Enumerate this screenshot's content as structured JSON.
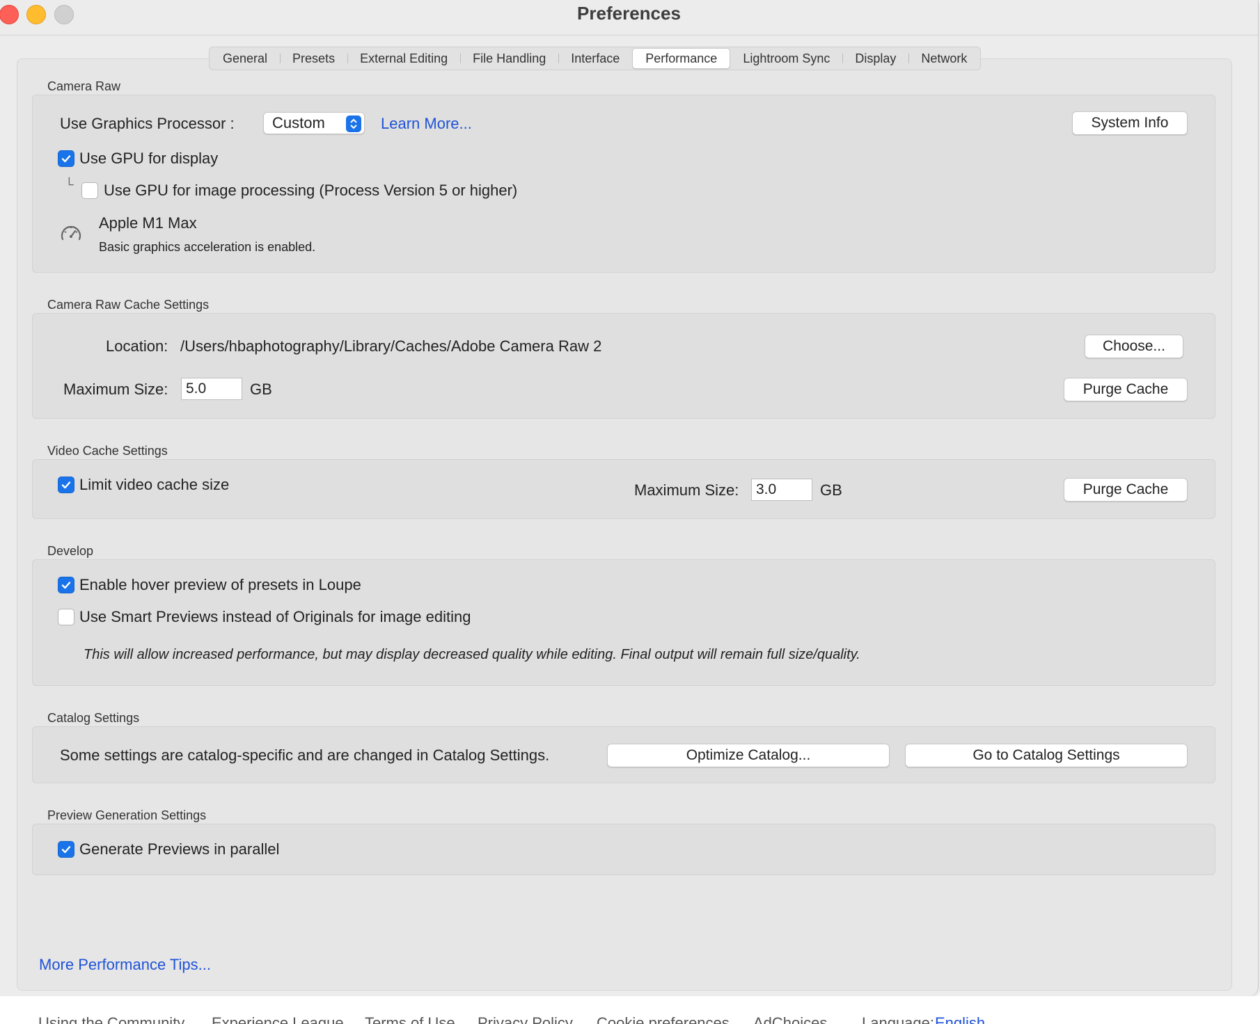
{
  "window": {
    "title": "Preferences"
  },
  "tabs": [
    {
      "label": "General"
    },
    {
      "label": "Presets"
    },
    {
      "label": "External Editing"
    },
    {
      "label": "File Handling"
    },
    {
      "label": "Interface"
    },
    {
      "label": "Performance",
      "active": true
    },
    {
      "label": "Lightroom Sync"
    },
    {
      "label": "Display"
    },
    {
      "label": "Network"
    }
  ],
  "camera_raw": {
    "section_label": "Camera Raw",
    "gpu_label": "Use Graphics Processor :",
    "gpu_value": "Custom",
    "learn_more": "Learn More...",
    "system_info": "System Info",
    "use_gpu_display": "Use GPU for display",
    "use_gpu_processing": "Use GPU for image processing (Process Version 5 or higher)",
    "gpu_name": "Apple M1 Max",
    "gpu_status": "Basic graphics acceleration is enabled."
  },
  "cache": {
    "section_label": "Camera Raw Cache Settings",
    "location_label": "Location:",
    "location_value": "/Users/hbaphotography/Library/Caches/Adobe Camera Raw 2",
    "choose": "Choose...",
    "max_size_label": "Maximum Size:",
    "max_size_value": "5.0",
    "unit": "GB",
    "purge": "Purge Cache"
  },
  "video_cache": {
    "section_label": "Video Cache Settings",
    "limit_label": "Limit video cache size",
    "max_size_label": "Maximum Size:",
    "max_size_value": "3.0",
    "unit": "GB",
    "purge": "Purge Cache"
  },
  "develop": {
    "section_label": "Develop",
    "hover_preview": "Enable hover preview of presets in Loupe",
    "smart_previews": "Use Smart Previews instead of Originals for image editing",
    "note": "This will allow increased performance, but may display decreased quality while editing. Final output will remain full size/quality."
  },
  "catalog": {
    "section_label": "Catalog Settings",
    "text": "Some settings are catalog-specific and are changed in Catalog Settings.",
    "optimize": "Optimize Catalog...",
    "goto": "Go to Catalog Settings"
  },
  "preview_gen": {
    "section_label": "Preview Generation Settings",
    "parallel": "Generate Previews in parallel"
  },
  "more_tips": "More Performance Tips...",
  "footer": {
    "items": [
      "Using the Community",
      "Experience League",
      "Terms of Use",
      "Privacy Policy",
      "Cookie preferences",
      "AdChoices"
    ],
    "language_label": "Language:",
    "language_value": "English"
  }
}
